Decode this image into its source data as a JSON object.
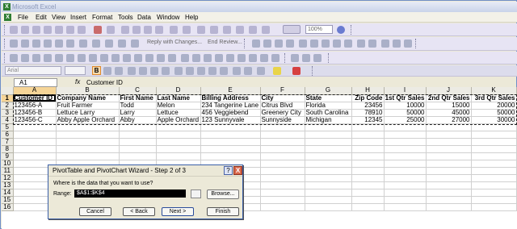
{
  "window": {
    "title": "Microsoft Excel"
  },
  "menu": [
    "File",
    "Edit",
    "View",
    "Insert",
    "Format",
    "Tools",
    "Data",
    "Window",
    "Help"
  ],
  "toolbar": {
    "reply_label": "Reply with Changes...",
    "end_review_label": "End Review...",
    "zoom": "100%",
    "font": "Arial",
    "bold": "B"
  },
  "formula": {
    "name_box": "A1",
    "fx": "fx",
    "content": "Customer ID"
  },
  "sheet": {
    "columns": [
      "A",
      "B",
      "C",
      "D",
      "E",
      "F",
      "G",
      "H",
      "I",
      "J",
      "K"
    ],
    "rows": [
      "1",
      "2",
      "3",
      "4",
      "5",
      "6",
      "7",
      "8",
      "9",
      "10",
      "11",
      "12",
      "13",
      "14",
      "15",
      "16"
    ],
    "headers": [
      "Customer ID",
      "Company Name",
      "First Name",
      "Last Name",
      "Billing Address",
      "City",
      "State",
      "Zip Code",
      "1st Qtr Sales",
      "2nd Qtr Sales",
      "3rd Qtr Sales"
    ],
    "data": [
      [
        "123456-A",
        "Fruit Farmer",
        "Todd",
        "Melon",
        "234 Tangerine Lane",
        "Citrus Blvd",
        "Florida",
        "23456",
        "10000",
        "15000",
        "20000"
      ],
      [
        "123456-B",
        "Lettuce Larry",
        "Larry",
        "Lettuce",
        "456 Veggiebend",
        "Greenery City",
        "South Carolina",
        "78910",
        "50000",
        "45000",
        "50000"
      ],
      [
        "123456-C",
        "Abby Apple Orchard",
        "Abby",
        "Apple Orchard",
        "123 Sunnyvale",
        "Sunnyside",
        "Michigan",
        "12345",
        "25000",
        "27000",
        "30000"
      ]
    ]
  },
  "dialog": {
    "title": "PivotTable and PivotChart Wizard - Step 2 of 3",
    "prompt": "Where is the data that you want to use?",
    "range_label": "Range:",
    "range_value": "$A$1:$K$4",
    "browse": "Browse...",
    "cancel": "Cancel",
    "back": "< Back",
    "next": "Next >",
    "finish": "Finish",
    "help": "?",
    "close": "X"
  },
  "colors": {
    "accent": "#3a5fa8",
    "close": "#d9674b",
    "excel_green": "#2e7d32"
  }
}
